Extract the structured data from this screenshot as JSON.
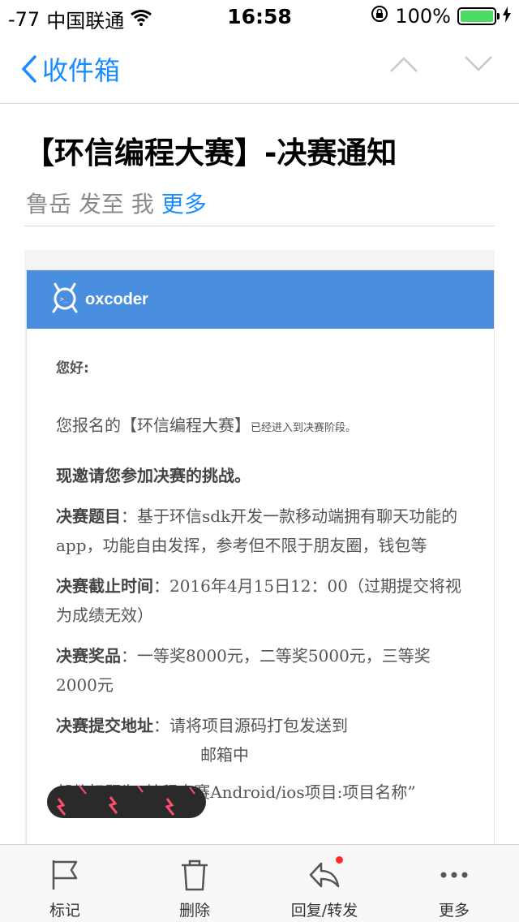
{
  "status_bar": {
    "signal": "-77",
    "carrier": "中国联通",
    "time": "16:58",
    "battery": "100%",
    "battery_color": "#4cd964"
  },
  "nav": {
    "back_label": "收件箱",
    "prev_icon": "chevron-up-icon",
    "next_icon": "chevron-down-icon",
    "accent": "#1a8cff"
  },
  "mail": {
    "subject": "【环信编程大赛】-决赛通知",
    "sender": "鲁岳",
    "sent_to": "发至 我",
    "more_link": "更多"
  },
  "body": {
    "brand": "oxcoder",
    "brand_color": "#4a8ee0",
    "greeting": "您好:",
    "p1_main": "您报名的【环信编程大赛】",
    "p1_small": "已经进入到决赛阶段。",
    "p2": "现邀请您参加决赛的挑战。",
    "topic_label": "决赛题目",
    "topic_text": "：基于环信sdk开发一款移动端拥有聊天功能的app，功能自由发挥，参考但不限于朋友圈，钱包等",
    "deadline_label": "决赛截止时间",
    "deadline_text": "：2016年4月15日12：00（过期提交将视为成绩无效）",
    "prize_label": "决赛奖品",
    "prize_text": "：一等奖8000元，二等奖5000元，三等奖2000元",
    "submit_label": "决赛提交地址",
    "submit_text": "：请将项目源码打包发送到",
    "submit_tail": "邮箱中",
    "subject_hint": "邮件标题为“编程大赛Android/ios项目:项目名称”"
  },
  "toolbar": {
    "flag_label": "标记",
    "delete_label": "删除",
    "reply_label": "回复/转发",
    "more_label": "更多"
  }
}
